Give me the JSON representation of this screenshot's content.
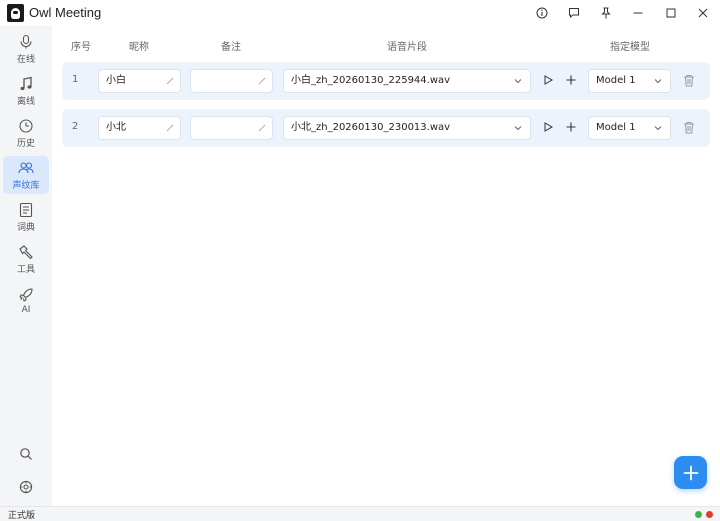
{
  "app": {
    "title": "Owl Meeting"
  },
  "sidebar": {
    "items": [
      {
        "label": "在线",
        "icon": "mic-icon",
        "active": false
      },
      {
        "label": "离线",
        "icon": "music-note-icon",
        "active": false
      },
      {
        "label": "历史",
        "icon": "clock-icon",
        "active": false
      },
      {
        "label": "声纹库",
        "icon": "users-icon",
        "active": true
      },
      {
        "label": "词典",
        "icon": "dictionary-icon",
        "active": false
      },
      {
        "label": "工具",
        "icon": "hammer-icon",
        "active": false
      },
      {
        "label": "AI",
        "icon": "rocket-icon",
        "active": false
      }
    ],
    "bottom": [
      {
        "icon": "search-icon"
      },
      {
        "icon": "settings-icon"
      }
    ]
  },
  "table": {
    "headers": {
      "index": "序号",
      "nickname": "昵称",
      "note": "备注",
      "clip": "语音片段",
      "model": "指定模型"
    },
    "rows": [
      {
        "index": "1",
        "nickname": "小白",
        "note": "",
        "clip": "小白_zh_20260130_225944.wav",
        "model": "Model 1"
      },
      {
        "index": "2",
        "nickname": "小北",
        "note": "",
        "clip": "小北_zh_20260130_230013.wav",
        "model": "Model 1"
      }
    ]
  },
  "status": {
    "edition": "正式版",
    "dot_colors": [
      "#3cb54a",
      "#e53935"
    ]
  },
  "colors": {
    "accent": "#2d8cf0",
    "active_nav_bg": "#dbe8fb",
    "row_bg": "#ecf3fd"
  }
}
